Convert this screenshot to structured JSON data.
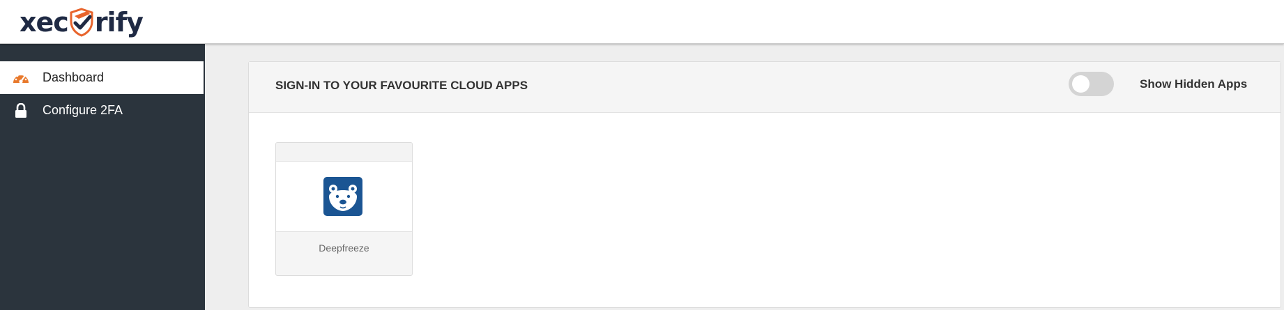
{
  "brand": {
    "logo_left": "xec",
    "logo_right": "rify",
    "logo_shield_icon": "shield-check-logo",
    "colors": {
      "navy": "#1f2a44",
      "accent": "#e8642c"
    }
  },
  "sidebar": {
    "background": "#2b343d",
    "items": [
      {
        "label": "Dashboard",
        "icon": "dashboard-gauge-icon",
        "active": true
      },
      {
        "label": "Configure 2FA",
        "icon": "lock-icon",
        "active": false
      }
    ]
  },
  "panel": {
    "title": "SIGN-IN TO YOUR FAVOURITE CLOUD APPS",
    "toggle_label": "Show Hidden Apps",
    "toggle_on": false,
    "apps": [
      {
        "name": "Deepfreeze",
        "icon": "polar-bear-icon",
        "icon_bg": "#1b5593"
      }
    ]
  }
}
